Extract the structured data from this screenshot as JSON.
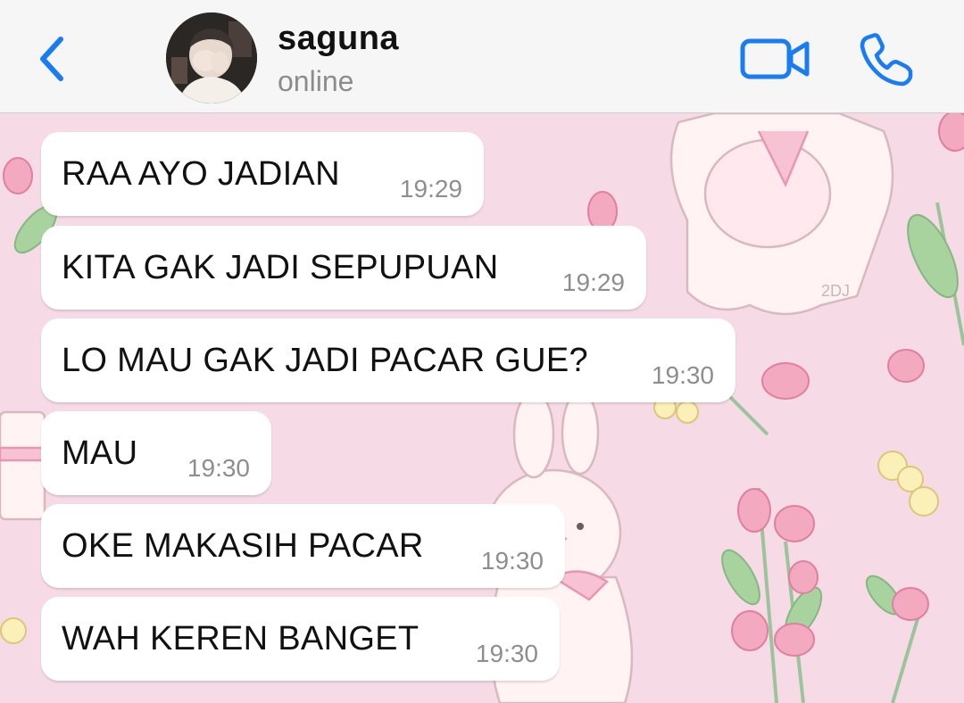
{
  "header": {
    "contact_name": "saguna",
    "status": "online",
    "accent_color": "#1a7cf5"
  },
  "icons": {
    "back": "chevron-left-icon",
    "video": "video-camera-icon",
    "call": "phone-icon"
  },
  "chat": {
    "wallpaper_color": "#f6dbe6",
    "messages": [
      {
        "text": "RAA AYO JADIAN",
        "time": "19:29"
      },
      {
        "text": "KITA GAK JADI SEPUPUAN",
        "time": "19:29"
      },
      {
        "text": "LO MAU GAK JADI PACAR GUE?",
        "time": "19:30"
      },
      {
        "text": "MAU",
        "time": "19:30"
      },
      {
        "text": "OKE MAKASIH PACAR",
        "time": "19:30"
      },
      {
        "text": "WAH KEREN BANGET",
        "time": "19:30"
      }
    ]
  }
}
